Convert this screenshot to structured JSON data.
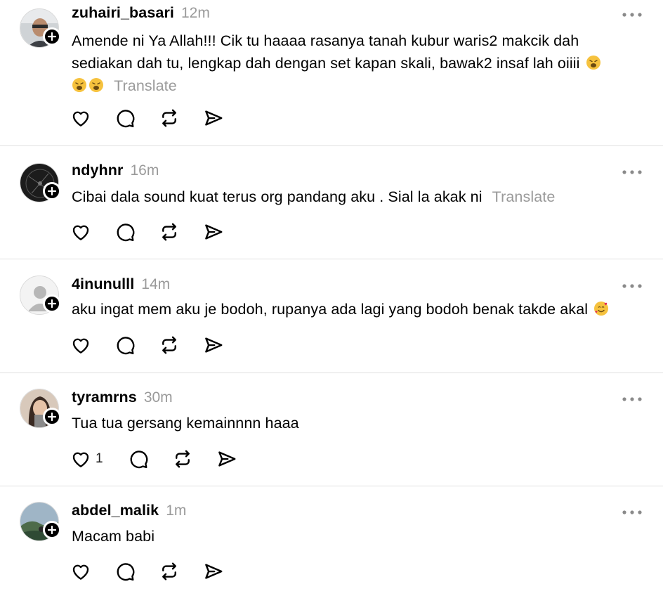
{
  "posts": [
    {
      "username": "zuhairi_basari",
      "time": "12m",
      "text_line1": "Amende ni Ya Allah!!! Cik tu haaaa rasanya tanah kubur waris2 makcik dah",
      "text_line2": "sediakan dah tu, lengkap dah dengan set kapan skali, bawak2 insaf lah oiiii",
      "translate_label": "Translate",
      "like_count": ""
    },
    {
      "username": "ndyhnr",
      "time": "16m",
      "text_line1": "Cibai dala sound kuat terus org pandang aku . Sial la akak ni",
      "translate_label": "Translate",
      "like_count": ""
    },
    {
      "username": "4inunulll",
      "time": "14m",
      "text_line1": "aku ingat mem aku je bodoh, rupanya ada lagi yang bodoh benak takde akal",
      "like_count": ""
    },
    {
      "username": "tyramrns",
      "time": "30m",
      "text_line1": "Tua tua gersang kemainnnn haaa",
      "like_count": "1"
    },
    {
      "username": "abdel_malik",
      "time": "1m",
      "text_line1": "Macam babi",
      "like_count": ""
    }
  ],
  "icons": {
    "like": "heart-icon",
    "reply": "comment-icon",
    "repost": "repost-icon",
    "share": "send-icon",
    "more": "more-options-icon",
    "follow": "plus-icon"
  },
  "colors": {
    "text": "#000000",
    "muted": "#9a9a9a",
    "divider": "#e0e0e0",
    "emoji": "#f6c23e"
  }
}
